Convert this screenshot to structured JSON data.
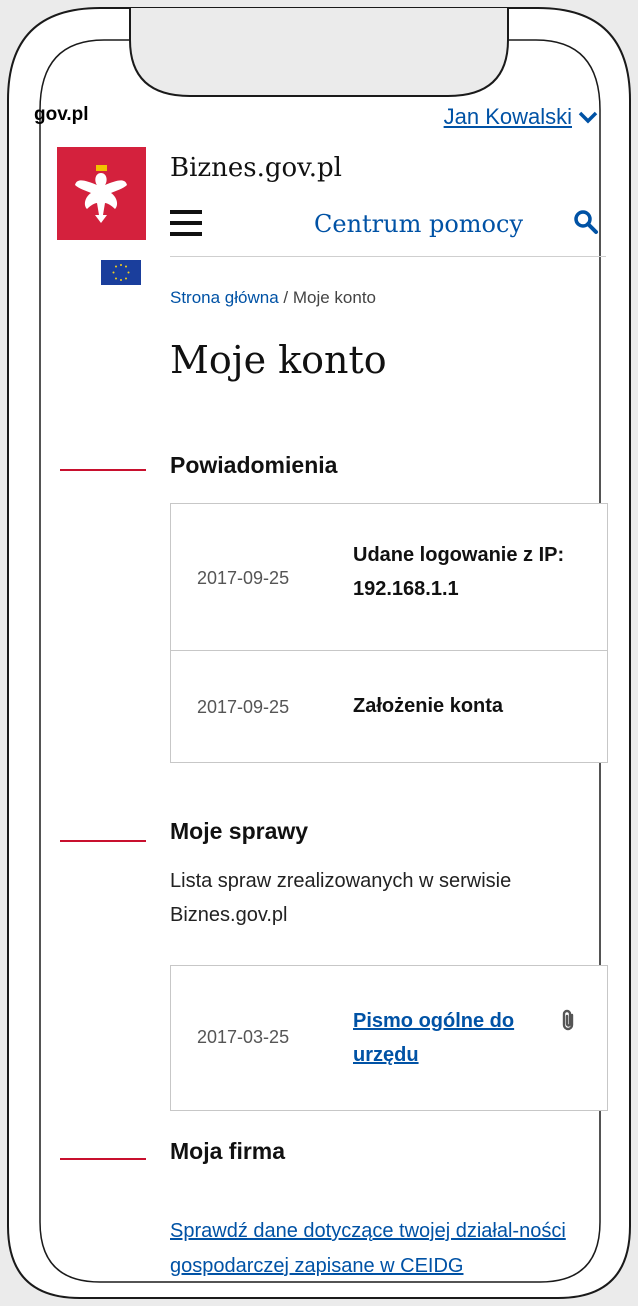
{
  "header": {
    "gov_logo": "gov.pl",
    "user_name": "Jan Kowalski",
    "site_title": "Biznes.gov.pl",
    "help_link": "Centrum pomocy"
  },
  "breadcrumb": {
    "home": "Strona główna",
    "separator": " / ",
    "current": "Moje konto"
  },
  "page": {
    "title": "Moje konto"
  },
  "notifications": {
    "heading": "Powiadomienia",
    "items": [
      {
        "date": "2017-09-25",
        "text": "Udane logowanie z IP: 192.168.1.1"
      },
      {
        "date": "2017-09-25",
        "text": "Założenie konta"
      }
    ]
  },
  "cases": {
    "heading": "Moje sprawy",
    "description": "Lista spraw zrealizowanych w serwisie Biznes.gov.pl",
    "items": [
      {
        "date": "2017-03-25",
        "title": "Pismo ogólne do urzędu",
        "icon": "paperclip-icon"
      }
    ]
  },
  "company": {
    "heading": "Moja firma",
    "link": "Sprawdź dane dotyczące twojej działal-ności gospodarczej zapisane w CEIDG"
  },
  "colors": {
    "accent": "#0052a5",
    "brand_red": "#d4213d",
    "section_mark": "#c8102e",
    "eu_blue": "#1a3e9c"
  }
}
